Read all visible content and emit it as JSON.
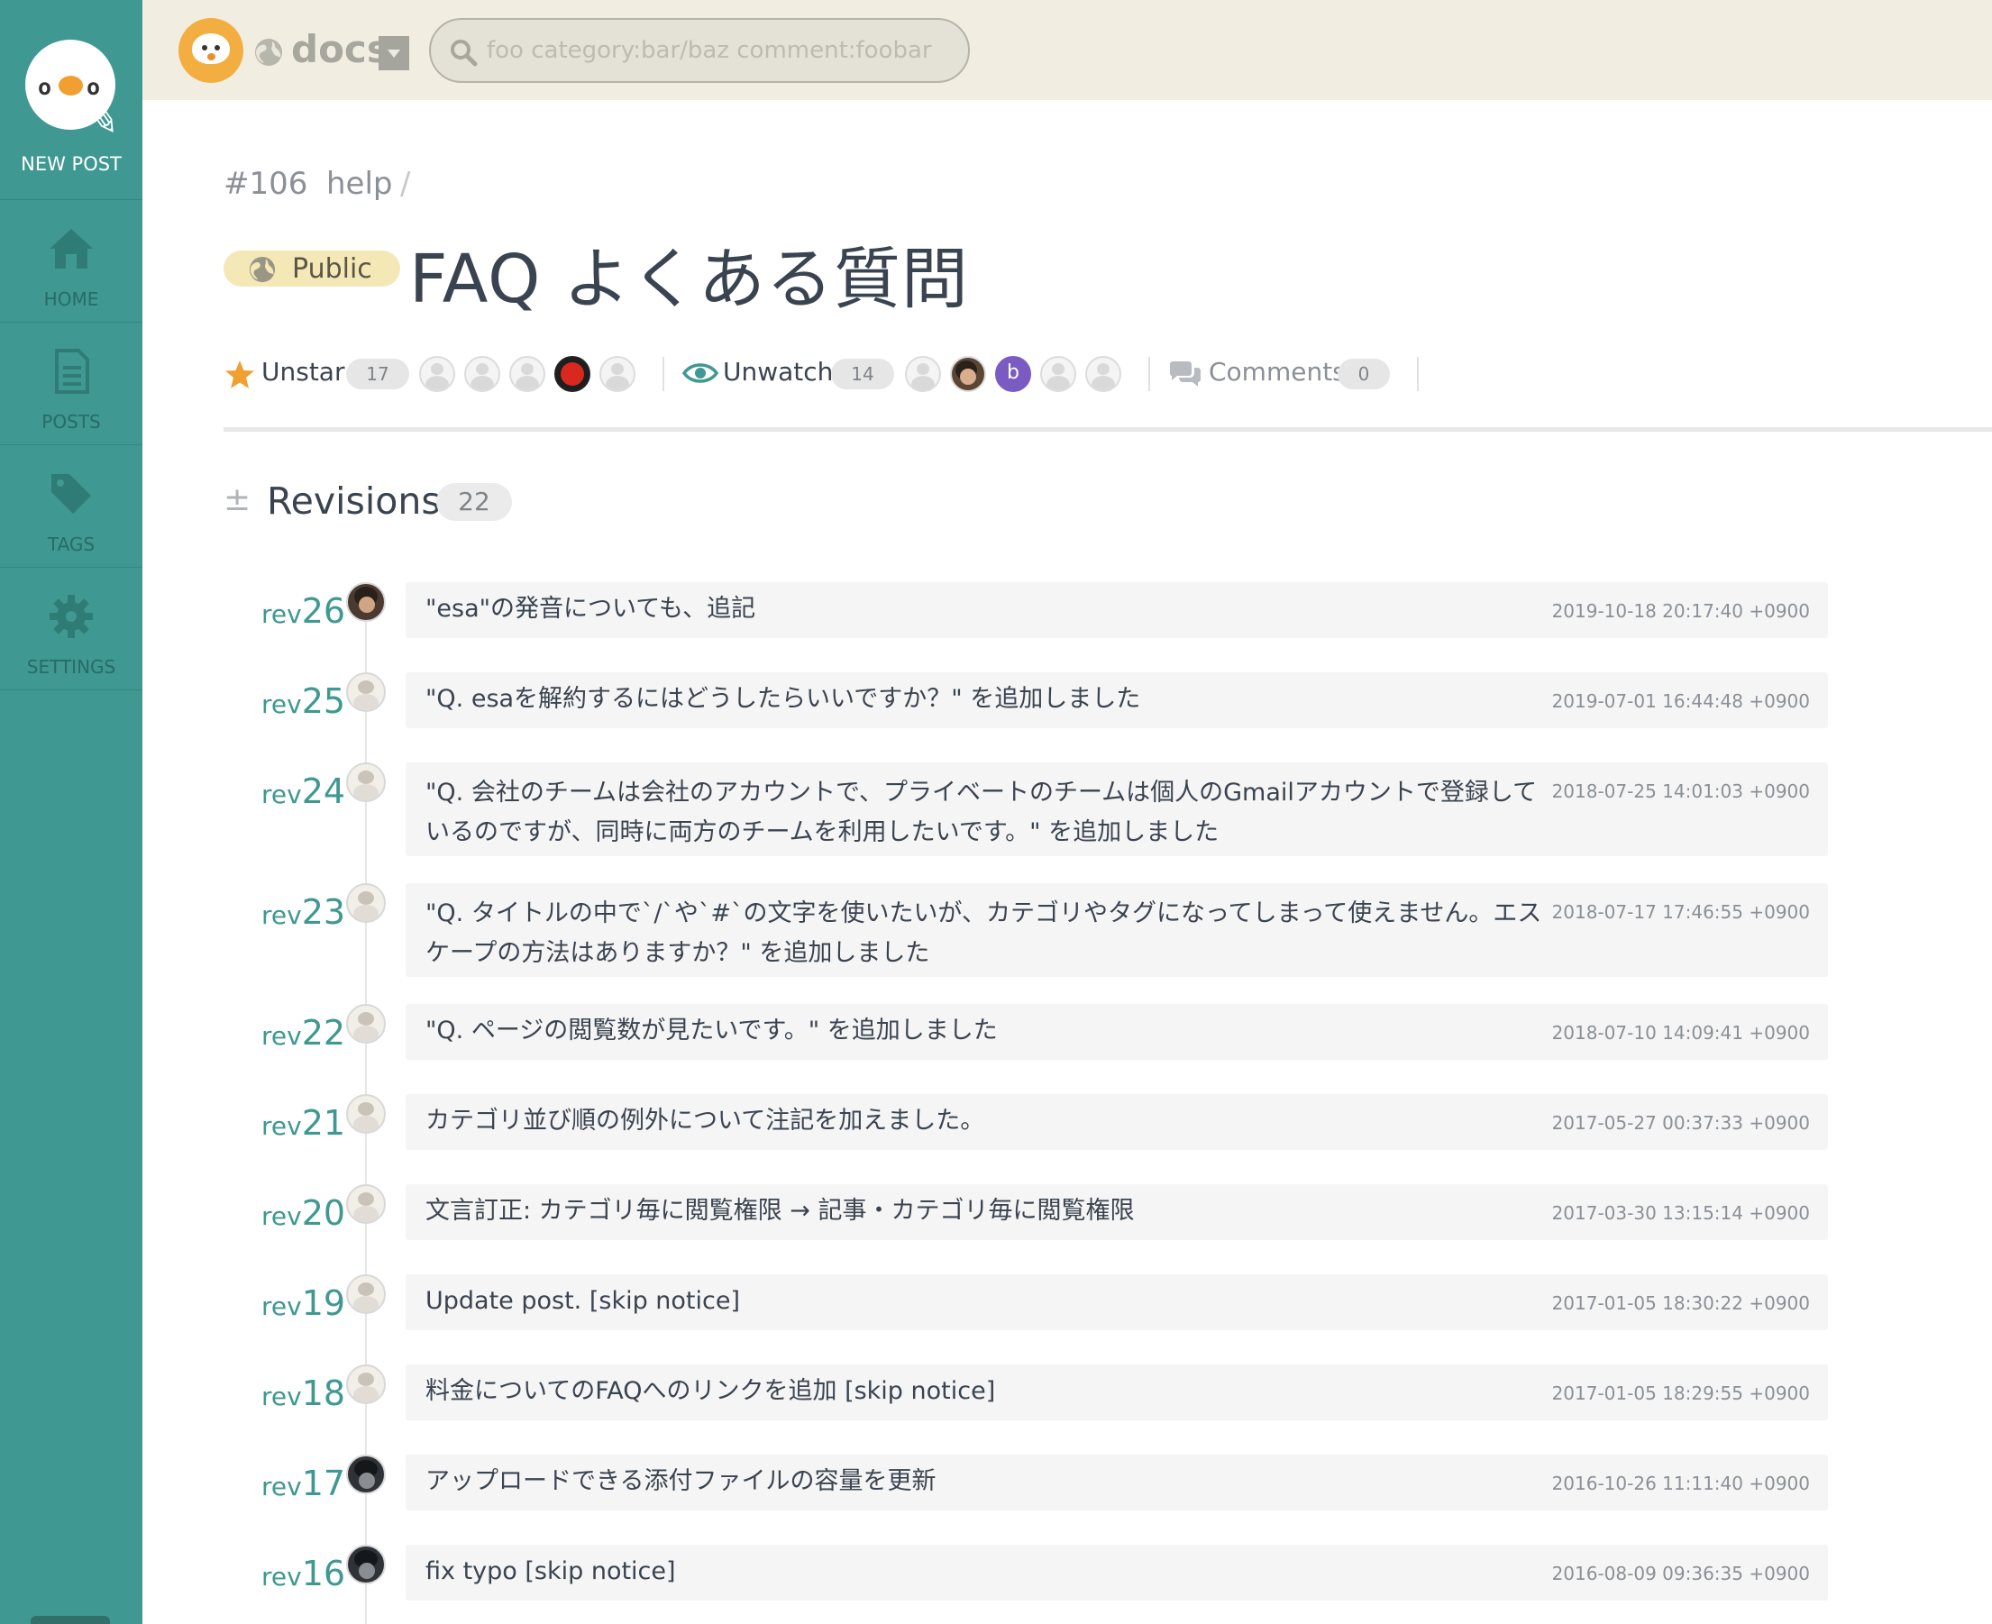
{
  "sidebar": {
    "new_post": "NEW POST",
    "home": "HOME",
    "posts": "POSTS",
    "tags": "TAGS",
    "settings": "SETTINGS"
  },
  "header": {
    "team_name": "docs",
    "search_placeholder": "foo category:bar/baz comment:foobar"
  },
  "post": {
    "number": "#106",
    "category": "help",
    "category_sep": "/",
    "visibility": "Public",
    "title": "FAQ よくある質問"
  },
  "actions": {
    "star_label": "Unstar",
    "star_count": "17",
    "watch_label": "Unwatch",
    "watch_count": "14",
    "watcher_initial": "b",
    "comments_label": "Comments",
    "comments_count": "0"
  },
  "revisions": {
    "title": "Revisions",
    "count": "22",
    "prefix": "rev",
    "items": [
      {
        "num": "26",
        "msg": "\"esa\"の発音についても、追記",
        "date": "2019-10-18 20:17:40 +0900"
      },
      {
        "num": "25",
        "msg": "\"Q. esaを解約するにはどうしたらいいですか？\" を追加しました",
        "date": "2019-07-01 16:44:48 +0900"
      },
      {
        "num": "24",
        "msg": "\"Q. 会社のチームは会社のアカウントで、プライベートのチームは個人のGmailアカウントで登録しているのですが、同時に両方のチームを利用したいです。\" を追加しました",
        "date": "2018-07-25 14:01:03 +0900"
      },
      {
        "num": "23",
        "msg": "\"Q. タイトルの中で`/`や`#`の文字を使いたいが、カテゴリやタグになってしまって使えません。エスケープの方法はありますか？\" を追加しました",
        "date": "2018-07-17 17:46:55 +0900"
      },
      {
        "num": "22",
        "msg": "\"Q. ページの閲覧数が見たいです。\" を追加しました",
        "date": "2018-07-10 14:09:41 +0900"
      },
      {
        "num": "21",
        "msg": "カテゴリ並び順の例外について注記を加えました。",
        "date": "2017-05-27 00:37:33 +0900"
      },
      {
        "num": "20",
        "msg": "文言訂正: カテゴリ毎に閲覧権限 → 記事・カテゴリ毎に閲覧権限",
        "date": "2017-03-30 13:15:14 +0900"
      },
      {
        "num": "19",
        "msg": "Update post. [skip notice]",
        "date": "2017-01-05 18:30:22 +0900"
      },
      {
        "num": "18",
        "msg": "料金についてのFAQへのリンクを追加 [skip notice]",
        "date": "2017-01-05 18:29:55 +0900"
      },
      {
        "num": "17",
        "msg": "アップロードできる添付ファイルの容量を更新",
        "date": "2016-10-26 11:11:40 +0900"
      },
      {
        "num": "16",
        "msg": "fix typo [skip notice]",
        "date": "2016-08-09 09:36:35 +0900"
      }
    ]
  }
}
